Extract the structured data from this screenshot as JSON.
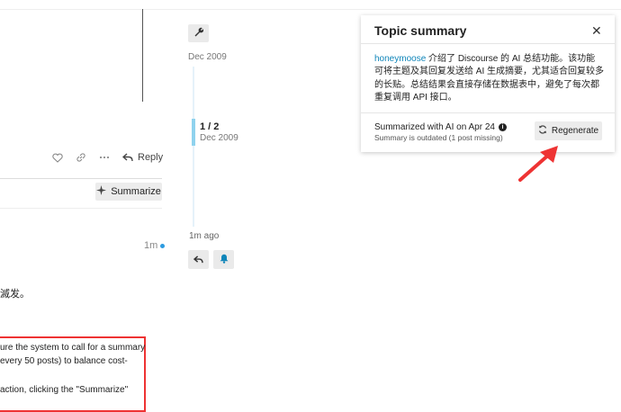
{
  "post": {
    "reply_label": "Reply",
    "summarize_label": "Summarize",
    "time_ago": "1m",
    "cn_fragment": "滅发。",
    "box_lines": [
      "ure the system to call for a summary",
      "every 50 posts) to balance cost-",
      "action, clicking the \"Summarize\""
    ]
  },
  "timeline": {
    "top_date": "Dec 2009",
    "position": "1 / 2",
    "position_date": "Dec 2009",
    "ago": "1m ago"
  },
  "summary_panel": {
    "title": "Topic summary",
    "close": "✕",
    "username": "honeymoose",
    "body_text": " 介绍了 Discourse 的 AI 总结功能。该功能可将主题及其回复发送给 AI 生成摘要，尤其适合回复较多的长贴。总结结果会直接存储在数据表中，避免了每次都重复调用 API 接口。",
    "meta": "Summarized with AI on Apr 24",
    "outdated": "Summary is outdated (1 post missing)",
    "regenerate_label": "Regenerate"
  },
  "colors": {
    "link": "#0f85b9",
    "timeline_handle": "#8fd2ee",
    "annotation": "#e33"
  },
  "icons": [
    "heart-icon",
    "link-icon",
    "ellipsis-icon",
    "reply-icon",
    "sparkle-icon",
    "wrench-icon",
    "bell-icon",
    "close-icon",
    "info-icon",
    "refresh-icon",
    "arrow-annotation-icon"
  ]
}
